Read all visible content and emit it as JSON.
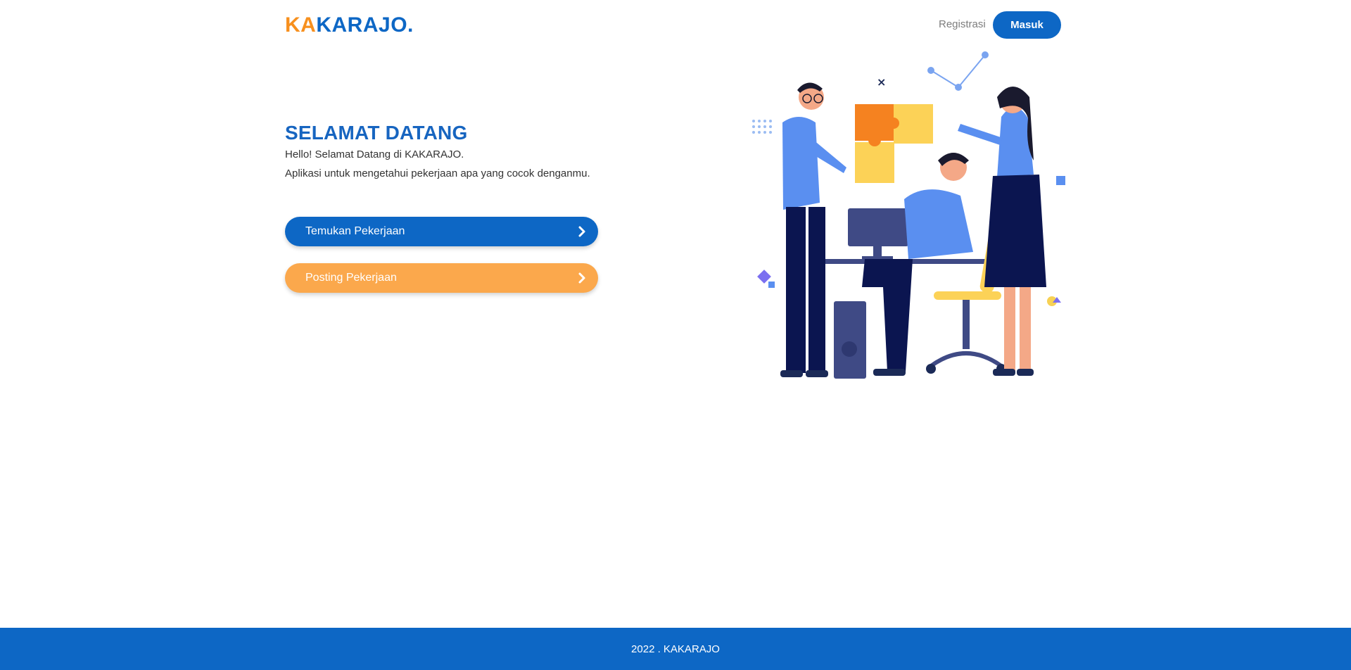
{
  "brand": {
    "logo_part1": "KA",
    "logo_part2": "KARAJO."
  },
  "nav": {
    "register_label": "Registrasi",
    "login_label": "Masuk"
  },
  "hero": {
    "title": "SELAMAT DATANG",
    "line1": "Hello! Selamat Datang di KAKARAJO.",
    "line2": "Aplikasi untuk mengetahui pekerjaan apa yang cocok denganmu.",
    "find_job_label": "Temukan Pekerjaan",
    "post_job_label": "Posting Pekerjaan"
  },
  "illustration": {
    "icon": "team-puzzle-illustration"
  },
  "footer": {
    "text": "2022 . KAKARAJO"
  },
  "colors": {
    "primary": "#0d67c5",
    "accent": "#f7901e",
    "orange_button": "#fba84c"
  }
}
